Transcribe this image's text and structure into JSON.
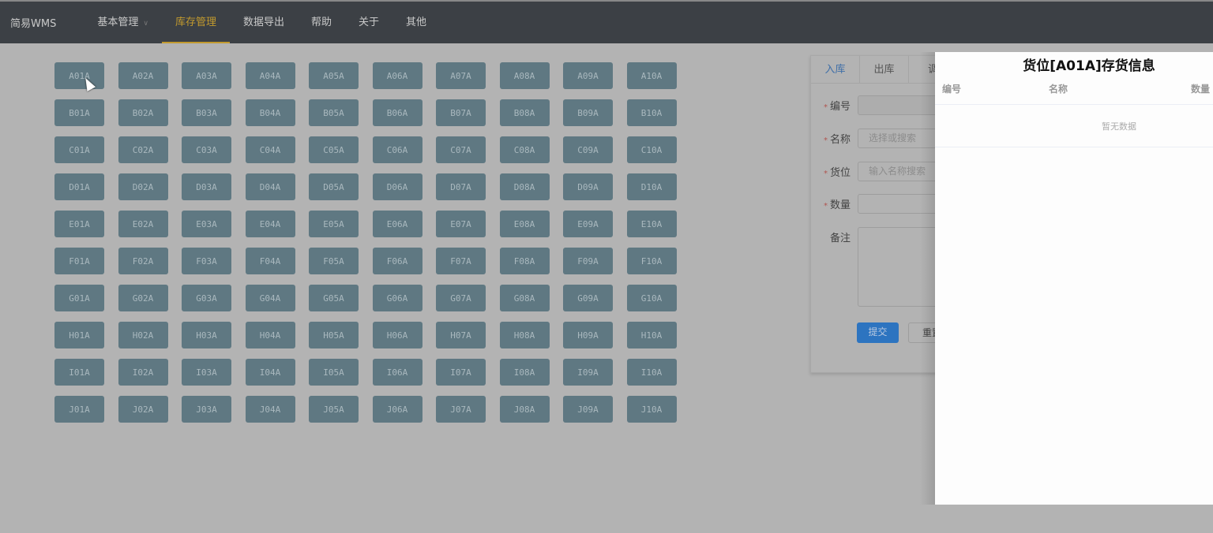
{
  "nav": {
    "brand": "简易WMS",
    "items": [
      {
        "label": "基本管理",
        "dropdown": true
      },
      {
        "label": "库存管理",
        "active": true
      },
      {
        "label": "数据导出"
      },
      {
        "label": "帮助"
      },
      {
        "label": "关于"
      },
      {
        "label": "其他"
      }
    ]
  },
  "locations": [
    "A",
    "B",
    "C",
    "D",
    "E",
    "F",
    "G",
    "H",
    "I",
    "J"
  ],
  "form": {
    "tabs": [
      "入库",
      "出库",
      "调"
    ],
    "fields": [
      {
        "label": "编号",
        "required": true,
        "placeholder": ""
      },
      {
        "label": "名称",
        "required": true,
        "placeholder": "选择或搜索"
      },
      {
        "label": "货位",
        "required": true,
        "placeholder": "输入名称搜索"
      },
      {
        "label": "数量",
        "required": true,
        "placeholder": ""
      }
    ],
    "remark_label": "备注",
    "submit": "提交",
    "reset": "重置"
  },
  "drawer": {
    "title": "货位[A01A]存货信息",
    "columns": [
      "编号",
      "名称",
      "数量"
    ],
    "empty": "暂无数据"
  }
}
